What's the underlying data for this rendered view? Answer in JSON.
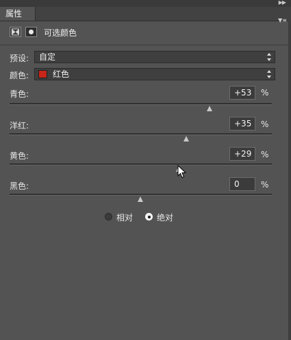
{
  "panel": {
    "tab_label": "属性",
    "collapse_icon": "double-chevron-right-icon",
    "menu_icon": "panel-menu-icon"
  },
  "header": {
    "adjustment_icon": "selective-color-icon",
    "mask_icon": "layer-mask-icon",
    "title": "可选颜色"
  },
  "preset": {
    "label": "预设:",
    "value": "自定"
  },
  "colors": {
    "label": "颜色:",
    "value": "红色",
    "swatch_color": "#c8261a"
  },
  "sliders": [
    {
      "label": "青色:",
      "value": "+53",
      "unit": "%",
      "level": 0.765
    },
    {
      "label": "洋红:",
      "value": "+35",
      "unit": "%",
      "level": 0.675
    },
    {
      "label": "黄色:",
      "value": "+29",
      "unit": "%",
      "level": 0.645
    },
    {
      "label": "黑色:",
      "value": "0",
      "unit": "%",
      "level": 0.5
    }
  ],
  "method": {
    "relative_label": "相对",
    "absolute_label": "绝对",
    "selected": "absolute"
  }
}
